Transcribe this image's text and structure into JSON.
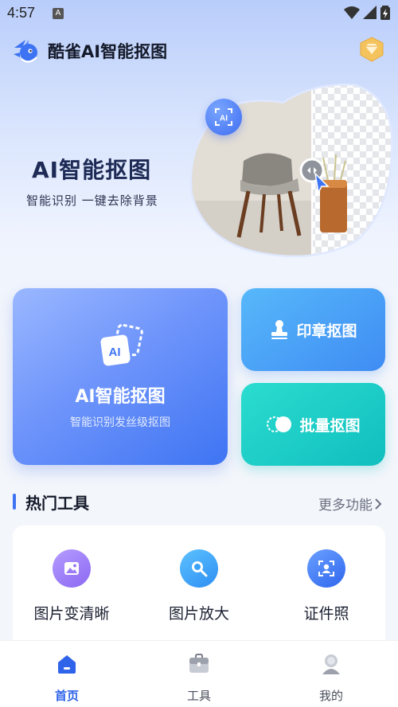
{
  "status_bar": {
    "time": "4:57",
    "app_icon_letter": "A"
  },
  "header": {
    "title": "酷雀AI智能抠图",
    "logo_icon": "bird-logo-icon",
    "vip_icon": "vip-diamond-icon"
  },
  "hero": {
    "title": "AI智能抠图",
    "subtitle": "智能识别  一键去除背景",
    "float_badge": "AI"
  },
  "cards": {
    "main": {
      "icon_text": "AI",
      "title": "AI智能抠图",
      "subtitle": "智能识别发丝级抠图"
    },
    "stamp": {
      "title": "印章抠图",
      "icon": "stamp-icon"
    },
    "batch": {
      "title": "批量抠图",
      "icon": "toggle-icon"
    }
  },
  "section": {
    "title": "热门工具",
    "more": "更多功能"
  },
  "tools": [
    {
      "label": "图片变清晰",
      "icon": "image-enhance-icon",
      "color": "#9b7cf6"
    },
    {
      "label": "图片放大",
      "icon": "magnifier-icon",
      "color": "#3aa2f7"
    },
    {
      "label": "证件照",
      "icon": "id-photo-icon",
      "color": "#3e7cf4"
    }
  ],
  "tabbar": [
    {
      "label": "首页",
      "icon": "home-icon",
      "active": true
    },
    {
      "label": "工具",
      "icon": "toolbox-icon",
      "active": false
    },
    {
      "label": "我的",
      "icon": "profile-icon",
      "active": false
    }
  ],
  "colors": {
    "accent": "#3e74f3",
    "teal": "#10bfbf",
    "sky": "#4fa6f8"
  }
}
